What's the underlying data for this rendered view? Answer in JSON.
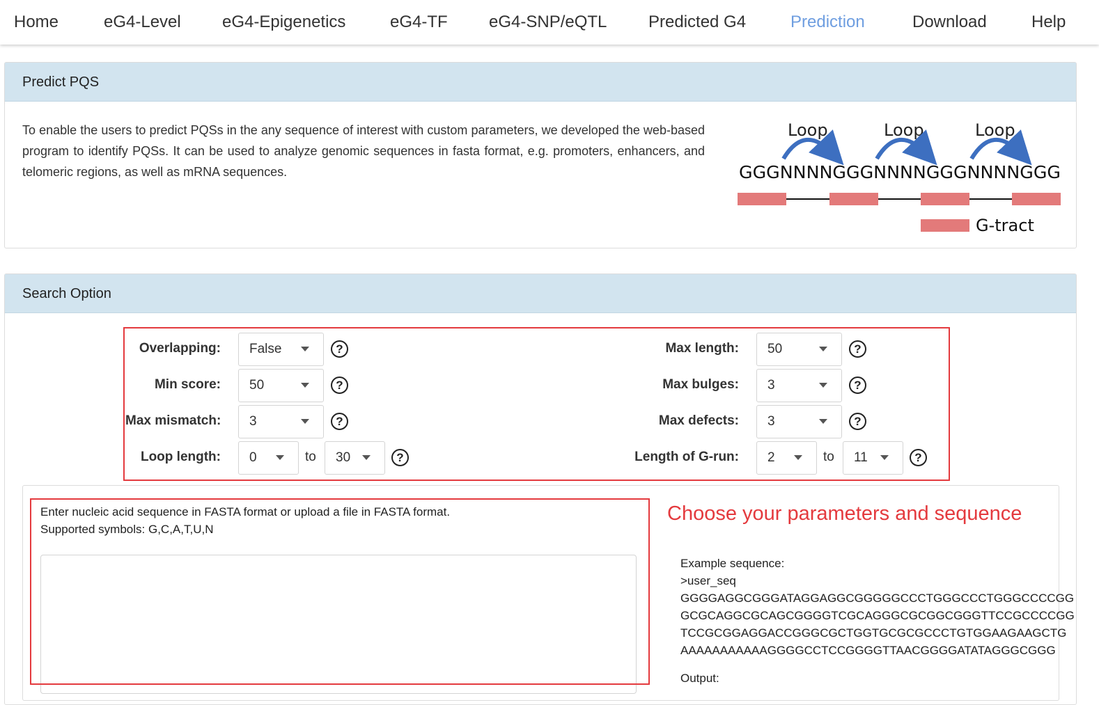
{
  "nav": {
    "items": [
      "Home",
      "eG4-Level",
      "eG4-Epigenetics",
      "eG4-TF",
      "eG4-SNP/eQTL",
      "Predicted G4",
      "Prediction",
      "Download",
      "Help"
    ],
    "active": "Prediction"
  },
  "predict": {
    "title": "Predict PQS",
    "description": "To enable the users to predict PQSs in the any sequence of interest with custom parameters, we developed the web-based program to identify PQSs. It can be used to analyze genomic sequences in fasta format, e.g. promoters, enhancers, and telomeric regions, as well as mRNA sequences.",
    "diagram": {
      "loop_label": "Loop",
      "sequence": "GGGNNNNGGGNNNNGGGNNNNGGG",
      "legend": "G-tract",
      "tract_color": "#e37a7a",
      "arrow_color": "#3d6fc0"
    }
  },
  "search": {
    "title": "Search Option",
    "overlapping": {
      "label": "Overlapping:",
      "value": "False"
    },
    "min_score": {
      "label": "Min score:",
      "value": "50"
    },
    "max_mismatch": {
      "label": "Max mismatch:",
      "value": "3"
    },
    "loop_length": {
      "label": "Loop length:",
      "from": "0",
      "to_word": "to",
      "to": "30"
    },
    "max_length": {
      "label": "Max length:",
      "value": "50"
    },
    "max_bulges": {
      "label": "Max bulges:",
      "value": "3"
    },
    "max_defects": {
      "label": "Max defects:",
      "value": "3"
    },
    "grun_length": {
      "label": "Length of G-run:",
      "from": "2",
      "to_word": "to",
      "to": "11"
    },
    "help_symbol": "?"
  },
  "sequence": {
    "help_line1": "Enter nucleic acid sequence in FASTA format or upload a file in FASTA format.",
    "help_line2": "Supported symbols: G,C,A,T,U,N",
    "textarea_value": "",
    "callout": "Choose your parameters and sequence",
    "example_title": "Example sequence:",
    "example_lines": [
      ">user_seq",
      "GGGGAGGCGGGATAGGAGGCGGGGGCCCTGGGCCCTGGGCCCCGG",
      "GCGCAGGCGCAGCGGGGTCGCAGGGCGCGGCGGGTTCCGCCCCGG",
      "TCCGCGGAGGACCGGGCGCTGGTGCGCGCCCTGTGGAAGAAGCTG",
      "AAAAAAAAAAAGGGGCCTCCGGGGTTAACGGGGATATAGGGCGGG"
    ],
    "output_label": "Output:"
  },
  "colors": {
    "accent": "#6f9ee0",
    "highlight": "#e43a3e",
    "panel_header": "#d2e4ef"
  }
}
